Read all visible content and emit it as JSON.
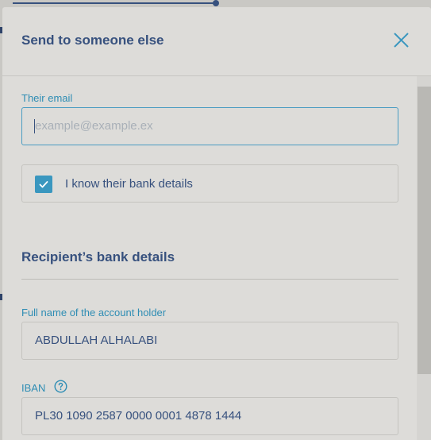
{
  "dialog": {
    "title": "Send to someone else",
    "close_icon": "close-icon"
  },
  "email": {
    "label": "Their email",
    "value": "",
    "placeholder": "example@example.ex"
  },
  "bank_details_toggle": {
    "label": "I know their bank details",
    "checked": true,
    "icon": "checkmark-icon"
  },
  "recipient_section": {
    "title": "Recipient’s bank details"
  },
  "account_holder": {
    "label": "Full name of the account holder",
    "value": "ABDULLAH ALHALABI"
  },
  "iban": {
    "label": "IBAN",
    "help_icon": "question-circle-icon",
    "value": "PL30 1090 2587 0000 0001 4878 1444"
  },
  "colors": {
    "primary_text": "#37517e",
    "accent": "#2e8db4",
    "checkbox": "#3a97bf",
    "modal_bg": "#dddcd9"
  }
}
